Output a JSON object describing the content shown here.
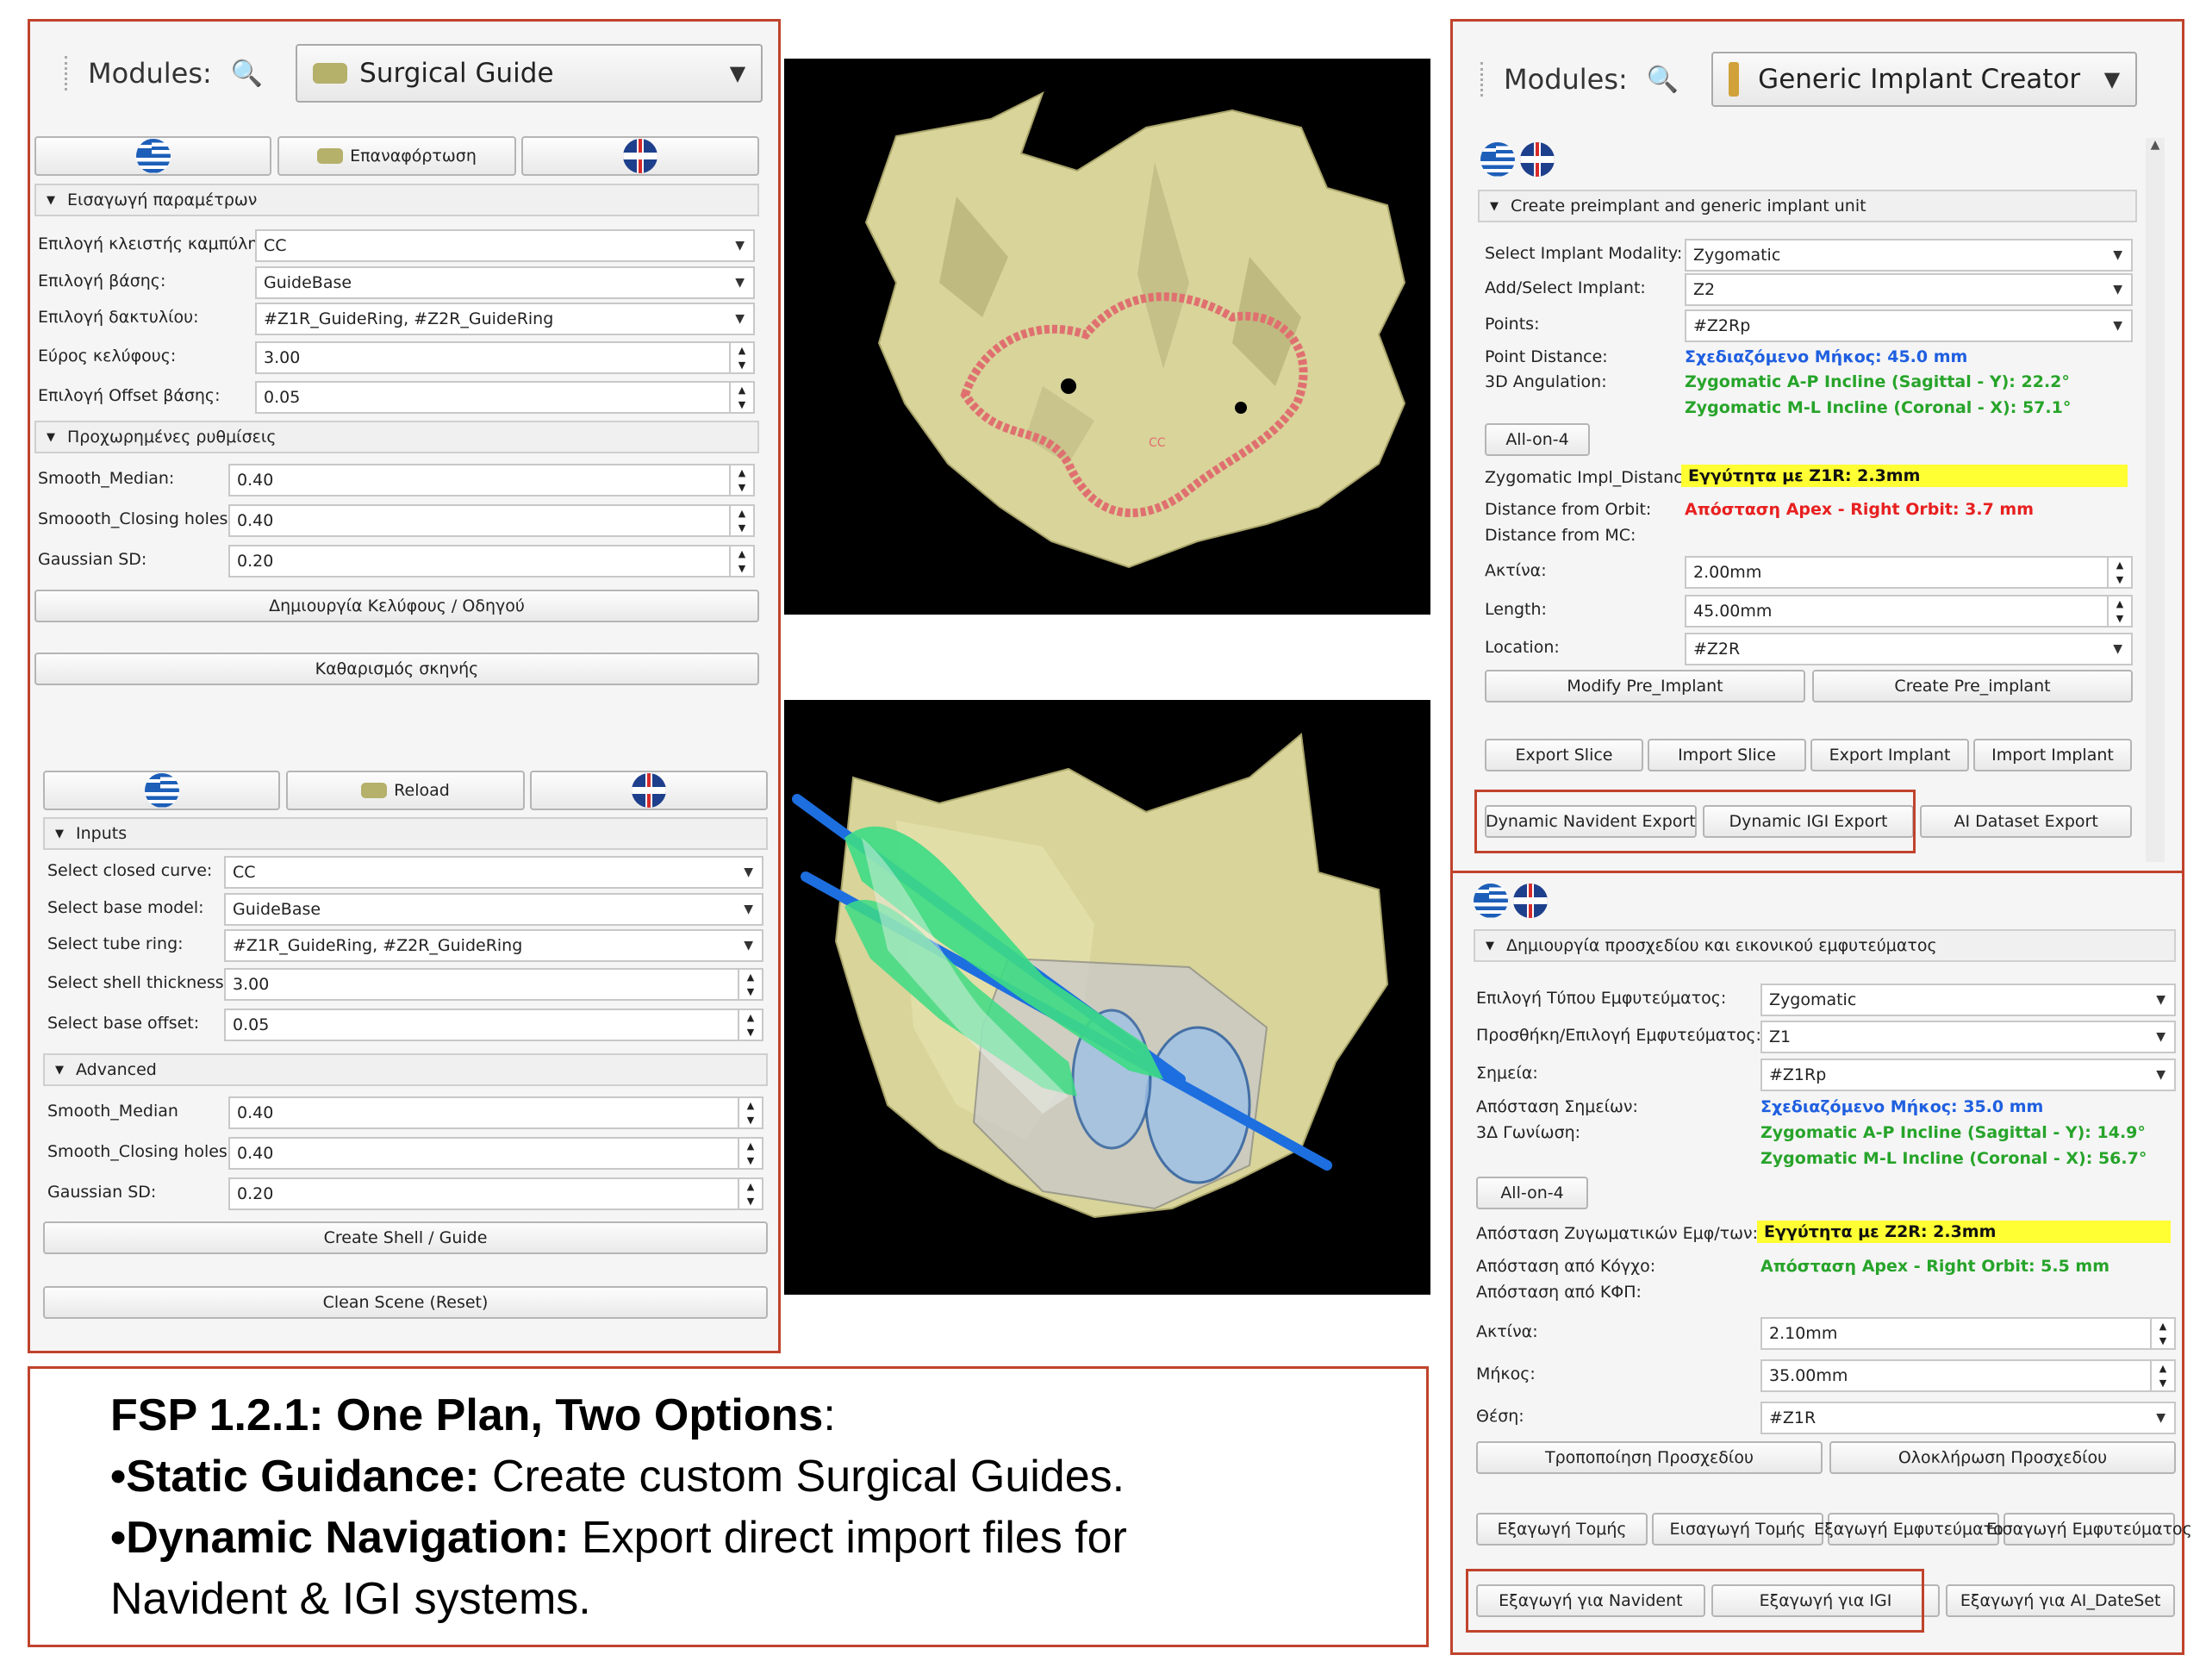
{
  "left_top": {
    "modules_label": "Modules:",
    "module_name": "Surgical Guide",
    "reload_label": "Επαναφόρτωση",
    "section_params": "Εισαγωγή παραμέτρων",
    "rows": [
      {
        "label": "Επιλογή κλειστής καμπύλης:",
        "value": "CC"
      },
      {
        "label": "Επιλογή βάσης:",
        "value": "GuideBase"
      },
      {
        "label": "Επιλογή δακτυλίου:",
        "value": "#Z1R_GuideRing, #Z2R_GuideRing"
      },
      {
        "label": "Εύρος κελύφους:",
        "value": "3.00"
      },
      {
        "label": "Επιλογή Offset βάσης:",
        "value": "0.05"
      }
    ],
    "section_advanced": "Προχωρημένες ρυθμίσεις",
    "adv_rows": [
      {
        "label": "Smooth_Median:",
        "value": "0.40"
      },
      {
        "label": "Smoooth_Closing holes:",
        "value": "0.40"
      },
      {
        "label": "Gaussian SD:",
        "value": "0.20"
      }
    ],
    "create_button": "Δημιουργία Κελύφους / Οδηγού",
    "clean_button": "Καθαρισμός σκηνής"
  },
  "left_bottom": {
    "reload_label": "Reload",
    "section_inputs": "Inputs",
    "rows": [
      {
        "label": "Select closed curve:",
        "value": "CC"
      },
      {
        "label": "Select base model:",
        "value": "GuideBase"
      },
      {
        "label": "Select tube ring:",
        "value": "#Z1R_GuideRing, #Z2R_GuideRing"
      },
      {
        "label": "Select shell thickness:",
        "value": "3.00"
      },
      {
        "label": "Select base offset:",
        "value": "0.05"
      }
    ],
    "section_advanced": "Advanced",
    "adv_rows": [
      {
        "label": "Smooth_Median",
        "value": "0.40"
      },
      {
        "label": "Smooth_Closing holes:",
        "value": "0.40"
      },
      {
        "label": "Gaussian SD:",
        "value": "0.20"
      }
    ],
    "create_button": "Create Shell / Guide",
    "clean_button": "Clean Scene (Reset)"
  },
  "viewer": {
    "curve_label": "CC"
  },
  "right_top": {
    "modules_label": "Modules:",
    "module_name": "Generic Implant Creator",
    "section": "Create preimplant and generic implant unit",
    "modality_label": "Select Implant Modality:",
    "modality_value": "Zygomatic",
    "implant_label": "Add/Select Implant:",
    "implant_value": "Z2",
    "points_label": "Points:",
    "points_value": "#Z2Rp",
    "point_distance_label": "Point Distance:",
    "point_distance_value": "Σχεδιαζόμενο Μήκος: 45.0 mm",
    "angulation_label": "3D Angulation:",
    "angulation_ap": "Zygomatic A-P Incline (Sagittal - Y): 22.2°",
    "angulation_ml": "Zygomatic M-L Incline (Coronal - X): 57.1°",
    "allon4": "All-on-4",
    "impl_distance_label": "Zygomatic Impl_Distance:",
    "impl_distance_value": "Εγγύτητα με Z1R: 2.3mm",
    "orbit_label": "Distance from Orbit:",
    "orbit_value": "Απόσταση Apex - Right Orbit: 3.7 mm",
    "mc_label": "Distance from MC:",
    "radius_label": "Ακτίνα:",
    "radius_value": "2.00mm",
    "length_label": "Length:",
    "length_value": "45.00mm",
    "location_label": "Location:",
    "location_value": "#Z2R",
    "modify_button": "Modify Pre_Implant",
    "create_button": "Create Pre_implant",
    "export_slice": "Export Slice",
    "import_slice": "Import Slice",
    "export_implant": "Export Implant",
    "import_implant": "Import Implant",
    "navident_export": "Dynamic Navident Export",
    "igi_export": "Dynamic IGI Export",
    "ai_export": "AI Dataset Export"
  },
  "right_bottom": {
    "section": "Δημιουργία προσχεδίου και εικονικού εμφυτεύματος",
    "modality_label": "Επιλογή Τύπου Εμφυτεύματος:",
    "modality_value": "Zygomatic",
    "implant_label": "Προσθήκη/Επιλογή Εμφυτεύματος:",
    "implant_value": "Z1",
    "points_label": "Σημεία:",
    "points_value": "#Z1Rp",
    "point_distance_label": "Απόσταση Σημείων:",
    "point_distance_value": "Σχεδιαζόμενο Μήκος: 35.0 mm",
    "angulation_label": "3Δ Γωνίωση:",
    "angulation_ap": "Zygomatic A-P Incline (Sagittal - Y): 14.9°",
    "angulation_ml": "Zygomatic M-L Incline (Coronal - X): 56.7°",
    "allon4": "All-on-4",
    "impl_distance_label": "Απόσταση Ζυγωματικών Εμφ/των:",
    "impl_distance_value": "Εγγύτητα με Z2R: 2.3mm",
    "orbit_label": "Απόσταση από Κόγχο:",
    "orbit_value": "Απόσταση Apex - Right Orbit: 5.5 mm",
    "mc_label": "Απόσταση από ΚΦΠ:",
    "radius_label": "Ακτίνα:",
    "radius_value": "2.10mm",
    "length_label": "Μήκος:",
    "length_value": "35.00mm",
    "location_label": "Θέση:",
    "location_value": "#Z1R",
    "modify_button": "Τροποποίηση Προσχεδίου",
    "create_button": "Ολοκλήρωση Προσχεδίου",
    "export_slice": "Εξαγωγή Τομής",
    "import_slice": "Εισαγωγή Τομής",
    "export_implant": "Εξαγωγή Εμφυτεύματος",
    "import_implant": "Εισαγωγή Εμφυτεύματος",
    "navident_export": "Εξαγωγή για Navident",
    "igi_export": "Εξαγωγή για IGI",
    "ai_export": "Εξαγωγή για AI_DateSet"
  },
  "caption": {
    "line1_bold": "FSP 1.2.1: One Plan, Two Options",
    "line1_rest": ":",
    "line2_bold": "•Static Guidance:",
    "line2_rest": " Create custom Surgical Guides.",
    "line3_bold": "•Dynamic Navigation:",
    "line3_rest": " Export direct import files for",
    "line4": " Navident & IGI systems."
  },
  "colors": {
    "frame": "#c0432c",
    "bone": "#d9d59a",
    "implant_green": "#3ddc84",
    "drill_blue": "#1d6fe0",
    "curve_pink": "#e07070"
  }
}
